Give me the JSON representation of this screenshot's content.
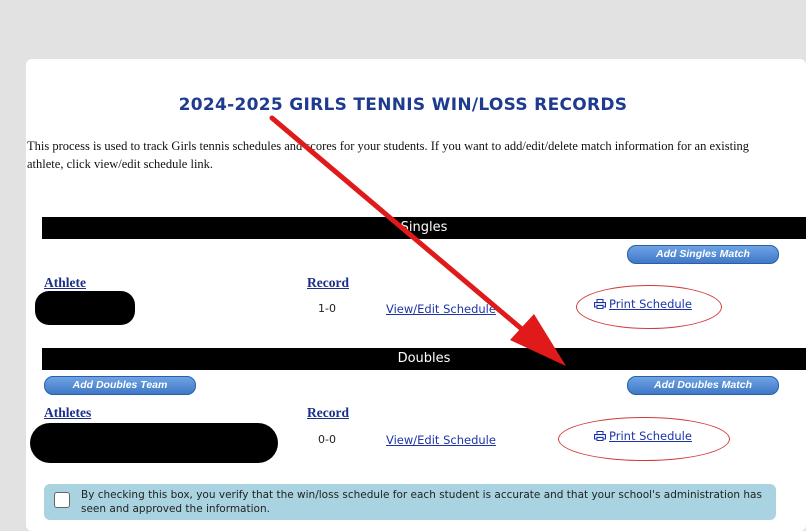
{
  "page": {
    "title": "2024-2025 GIRLS TENNIS WIN/LOSS RECORDS",
    "intro": "This process is used to track Girls tennis schedules and scores for your students. If you want to add/edit/delete match information for an existing athlete, click view/edit schedule link."
  },
  "singles": {
    "header": "Singles",
    "add_button": "Add Singles Match",
    "col_athlete": "Athlete",
    "col_record": "Record",
    "rows": [
      {
        "record": "1-0",
        "view_link": "View/Edit Schedule",
        "print_link": "Print Schedule"
      }
    ]
  },
  "doubles": {
    "header": "Doubles",
    "add_team_button": "Add Doubles Team",
    "add_button": "Add Doubles Match",
    "col_athletes": "Athletes",
    "col_record": "Record",
    "rows": [
      {
        "record": "0-0",
        "view_link": "View/Edit Schedule",
        "print_link": "Print Schedule"
      }
    ]
  },
  "verify": {
    "text": "By checking this box, you verify that the win/loss schedule for each student is accurate and that your school's administration has seen and approved the information."
  },
  "colors": {
    "title": "#1f3b8f",
    "link": "#1d33a8",
    "annotation": "#d23a3a",
    "button": "#3f78c7",
    "verify_bg": "#a9d3e0"
  },
  "icons": {
    "print": "printer-icon"
  }
}
